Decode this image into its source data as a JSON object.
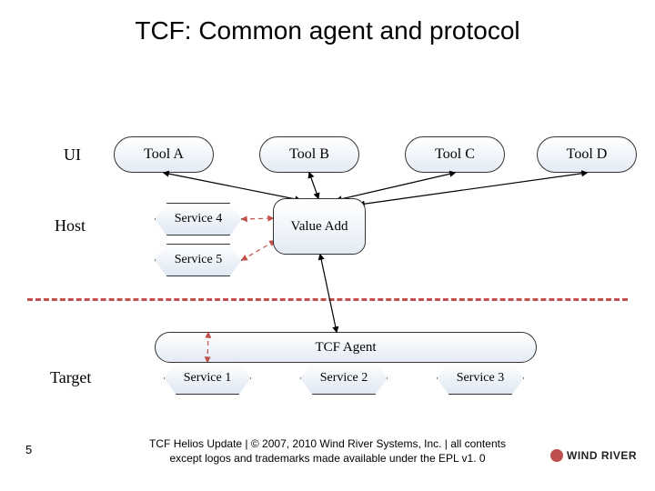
{
  "title": "TCF: Common agent and protocol",
  "labels": {
    "ui": "UI",
    "host": "Host",
    "target": "Target"
  },
  "tools": {
    "a": "Tool A",
    "b": "Tool B",
    "c": "Tool C",
    "d": "Tool D"
  },
  "valueadd": "Value Add",
  "services": {
    "s1": "Service 1",
    "s2": "Service 2",
    "s3": "Service 3",
    "s4": "Service 4",
    "s5": "Service 5"
  },
  "agent": "TCF Agent",
  "footer": {
    "line1": "TCF Helios Update | © 2007, 2010 Wind River Systems, Inc. | all contents",
    "line2": "except logos and trademarks made available under the EPL v1. 0"
  },
  "slide_number": "5",
  "logo_text": "WIND RIVER"
}
